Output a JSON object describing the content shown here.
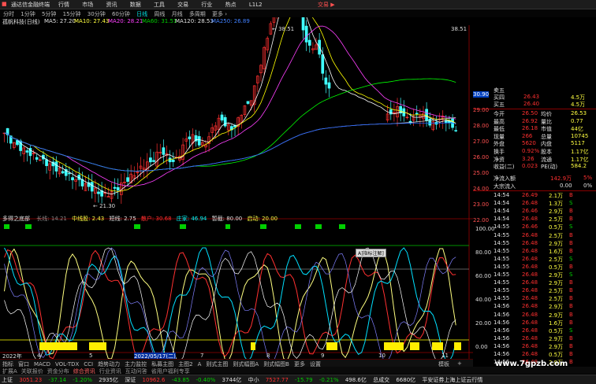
{
  "window": {
    "title": "通达信金融终端",
    "menu": [
      "行情",
      "市场",
      "资讯",
      "数据",
      "工具",
      "交易",
      "行业",
      "热点",
      "L1L2"
    ],
    "trade_button": "交易 ▶"
  },
  "period_bar": [
    "分时",
    "1分钟",
    "5分钟",
    "15分钟",
    "30分钟",
    "60分钟",
    "日线",
    "周线",
    "月线",
    "多周期",
    "更多 ›"
  ],
  "stock_header": {
    "name": "孤帆科技(日线)",
    "ma5": "MA5: 27.20",
    "ma10": "MA10: 27.43",
    "ma20": "MA20: 28.21",
    "ma60": "MA60: 31.51",
    "ma120": "MA120: 28.53",
    "ma250": "MA250: 26.89"
  },
  "price_axis": [
    "38.51",
    "30.90",
    "29.00",
    "28.00",
    "27.00",
    "26.00",
    "25.00",
    "24.00",
    "23.00",
    "22.00",
    "21.30"
  ],
  "annotations": {
    "high": "38.51",
    "low": "21.30"
  },
  "indicator_header": {
    "name": "多得之底部",
    "a": "长线: 14.21",
    "b": "中线股: 2.43",
    "c": "短线: 2.75",
    "d": "散户: 30.68",
    "e": "庄家: 46.94",
    "f": "暂截: 80.00",
    "g": "启动: 20.00"
  },
  "indicator_axis": [
    "100.00",
    "80.00",
    "60.00",
    "40.00",
    "20.00",
    "0.00"
  ],
  "tooltip": "A]指标注解]",
  "date_axis": [
    "2022年",
    "4",
    "5",
    "2022/05/17(二)",
    "7",
    "8",
    "9",
    "10",
    "11"
  ],
  "quote_panel": {
    "sell5": {
      "label": "卖五",
      "price": "",
      "vol": ""
    },
    "sell4": {
      "label": "买四",
      "price": "26.43",
      "vol": "4.5万"
    },
    "sell3": {
      "label": "买五",
      "price": "26.40",
      "vol": "4.5万"
    },
    "rows": [
      {
        "l": "今开",
        "v": "26.50",
        "l2": "均价",
        "v2": "26.53"
      },
      {
        "l": "最高",
        "v": "26.92",
        "l2": "量比",
        "v2": "0.77"
      },
      {
        "l": "最低",
        "v": "26.18",
        "l2": "市值",
        "v2": "44亿"
      },
      {
        "l": "现量",
        "v": "266",
        "l2": "总量",
        "v2": "10745"
      },
      {
        "l": "外盘",
        "v": "5620",
        "l2": "内盘",
        "v2": "5117"
      },
      {
        "l": "换手",
        "v": "0.92%",
        "l2": "股本",
        "v2": "1.17亿"
      },
      {
        "l": "净资",
        "v": "3.26",
        "l2": "流通",
        "v2": "1.17亿"
      },
      {
        "l": "收益(二)",
        "v": "0.023",
        "l2": "PE(动)",
        "v2": "584.2"
      }
    ],
    "net_inflow": {
      "label": "净流入额",
      "value": "142.9万",
      "pct": "5%"
    },
    "big_inflow": {
      "label": "大宗流入",
      "value": "0.00",
      "pct": "0%"
    },
    "ticks": [
      {
        "t": "14:54",
        "p": "26.49",
        "v": "2.1万",
        "d": "B",
        "c": "red"
      },
      {
        "t": "14:54",
        "p": "26.48",
        "v": "1.3万",
        "d": "S",
        "c": "green"
      },
      {
        "t": "14:54",
        "p": "26.46",
        "v": "2.9万",
        "d": "B",
        "c": "red"
      },
      {
        "t": "14:54",
        "p": "26.48",
        "v": "2.5万",
        "d": "B",
        "c": "red"
      },
      {
        "t": "14:55",
        "p": "26.46",
        "v": "0.5万",
        "d": "S",
        "c": "green"
      },
      {
        "t": "14:55",
        "p": "26.48",
        "v": "2.5万",
        "d": "B",
        "c": "red"
      },
      {
        "t": "14:55",
        "p": "26.48",
        "v": "2.9万",
        "d": "B",
        "c": "red"
      },
      {
        "t": "14:55",
        "p": "26.48",
        "v": "1.6万",
        "d": "B",
        "c": "red"
      },
      {
        "t": "14:55",
        "p": "26.48",
        "v": "2.5万",
        "d": "S",
        "c": "green"
      },
      {
        "t": "14:55",
        "p": "26.48",
        "v": "0.5万",
        "d": "B",
        "c": "red"
      },
      {
        "t": "14:55",
        "p": "26.48",
        "v": "2.9万",
        "d": "S",
        "c": "green"
      },
      {
        "t": "14:55",
        "p": "26.48",
        "v": "2.9万",
        "d": "B",
        "c": "red"
      },
      {
        "t": "14:55",
        "p": "26.48",
        "v": "2.5万",
        "d": "B",
        "c": "red"
      },
      {
        "t": "14:55",
        "p": "26.48",
        "v": "2.5万",
        "d": "B",
        "c": "red"
      },
      {
        "t": "14:56",
        "p": "26.48",
        "v": "2.9万",
        "d": "B",
        "c": "red"
      },
      {
        "t": "14:56",
        "p": "26.48",
        "v": "2.9万",
        "d": "B",
        "c": "red"
      },
      {
        "t": "14:56",
        "p": "26.48",
        "v": "1.6万",
        "d": "B",
        "c": "red"
      },
      {
        "t": "14:56",
        "p": "26.48",
        "v": "0.5万",
        "d": "S",
        "c": "green"
      },
      {
        "t": "14:56",
        "p": "26.48",
        "v": "2.9万",
        "d": "B",
        "c": "red"
      },
      {
        "t": "14:56",
        "p": "26.48",
        "v": "2.9万",
        "d": "B",
        "c": "red"
      },
      {
        "t": "14:56",
        "p": "26.48",
        "v": "0.5万",
        "d": "B",
        "c": "red"
      },
      {
        "t": "14:56",
        "p": "26.48",
        "v": "2.9万",
        "d": "B",
        "c": "red"
      }
    ]
  },
  "bottom_tabs": [
    "指标",
    "窗口",
    "MACD",
    "VOL-TDX",
    "CCI",
    "趋势动力",
    "主力监控",
    "私募主图",
    "主图2",
    "A",
    "则式主图",
    "则式幅图A",
    "则式幅图B",
    "更多",
    "设置"
  ],
  "bottom_links": [
    "扩展A",
    "关联报价",
    "资金分布",
    "综合资讯",
    "行业资讯",
    "互动问答",
    "省用户福利专享"
  ],
  "right_bottom": {
    "a": "模板",
    "b": "+"
  },
  "status": [
    {
      "label": "上证",
      "value": "3051.23",
      "change": "-37.14",
      "pct": "-1.20%",
      "amount": "2935亿"
    },
    {
      "label": "深证",
      "value": "10962.6",
      "change": "-43.85",
      "pct": "-0.40%",
      "amount": "3744亿"
    },
    {
      "label": "中小",
      "value": "7527.77",
      "change": "-15.79",
      "pct": "-0.21%",
      "amount": "498.6亿"
    }
  ],
  "status_extra": {
    "total": "总成交",
    "total_amt": "6680亿",
    "broker": "平安证券上海上证云行情"
  },
  "watermark": "www.7gpzb.com",
  "colors": {
    "up": "#ff3030",
    "down": "#00ffff",
    "ma5": "#ffffff",
    "ma10": "#ffff00",
    "ma20": "#ff00ff",
    "ma60": "#00ff00",
    "signal_bar": "#ffee00"
  }
}
